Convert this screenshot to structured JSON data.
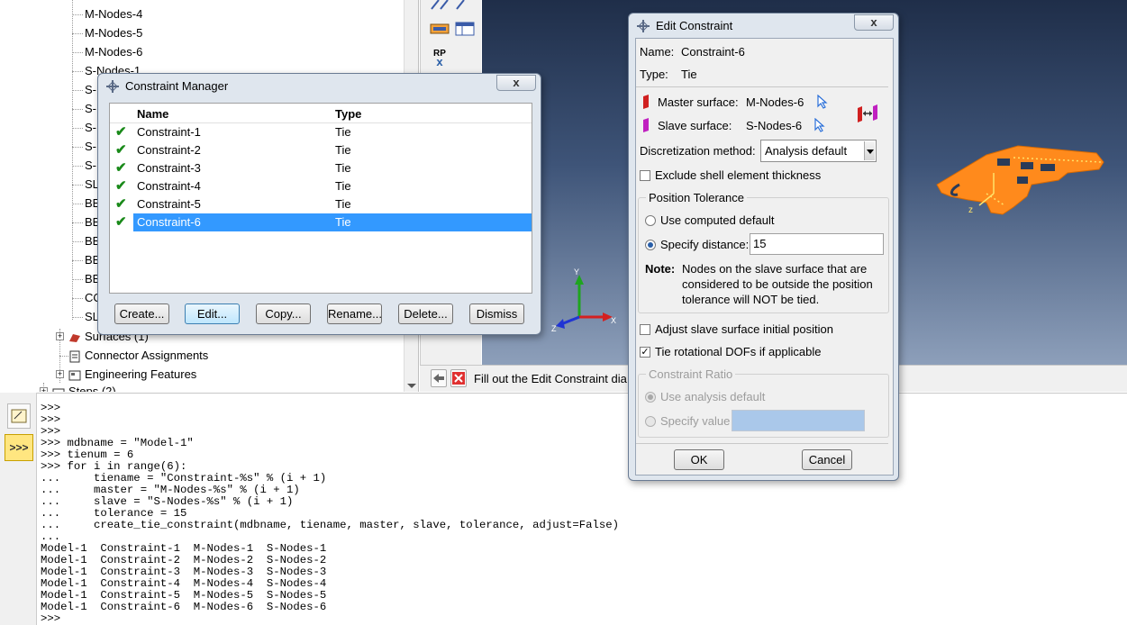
{
  "tree": {
    "items": [
      "M-Nodes-4",
      "M-Nodes-5",
      "M-Nodes-6",
      "S-Nodes-1",
      "S-N",
      "S-N",
      "S-N",
      "S-N",
      "S-N",
      "SLA",
      "BE",
      "BE",
      "BE",
      "BE",
      "BE",
      "CO",
      "SLA"
    ],
    "surfaces": "Surfaces (1)",
    "connector_assignments": "Connector Assignments",
    "engineering_features": "Engineering Features",
    "steps": "Steps (2)"
  },
  "toolbox": {
    "rp_label": "RP"
  },
  "prompt": {
    "text": "Fill out the Edit Constraint dia"
  },
  "viewport": {
    "axis_x": "X",
    "axis_y": "Y",
    "axis_z": "Z"
  },
  "constraint_manager": {
    "title": "Constraint Manager",
    "columns": [
      "Name",
      "Type"
    ],
    "rows": [
      {
        "name": "Constraint-1",
        "type": "Tie"
      },
      {
        "name": "Constraint-2",
        "type": "Tie"
      },
      {
        "name": "Constraint-3",
        "type": "Tie"
      },
      {
        "name": "Constraint-4",
        "type": "Tie"
      },
      {
        "name": "Constraint-5",
        "type": "Tie"
      },
      {
        "name": "Constraint-6",
        "type": "Tie"
      }
    ],
    "selected_index": 5,
    "buttons": {
      "create": "Create...",
      "edit": "Edit...",
      "copy": "Copy...",
      "rename": "Rename...",
      "delete": "Delete...",
      "dismiss": "Dismiss"
    }
  },
  "edit_constraint": {
    "title": "Edit Constraint",
    "name_label": "Name:",
    "name_value": "Constraint-6",
    "type_label": "Type:",
    "type_value": "Tie",
    "master_label": "Master surface:",
    "master_value": "M-Nodes-6",
    "slave_label": "Slave surface:",
    "slave_value": "S-Nodes-6",
    "discretization_label": "Discretization method:",
    "discretization_value": "Analysis default",
    "exclude_shell": "Exclude shell element thickness",
    "position_tolerance": {
      "title": "Position Tolerance",
      "use_computed": "Use computed default",
      "specify_distance": "Specify distance:",
      "distance_value": "15",
      "note_label": "Note:",
      "note_line1": "Nodes on the slave surface that are",
      "note_line2": "considered to be outside the position",
      "note_line3": "tolerance will NOT be tied."
    },
    "adjust_slave": "Adjust slave surface initial position",
    "adjust_checked": false,
    "tie_rotational": "Tie rotational DOFs if applicable",
    "tie_checked": true,
    "constraint_ratio": {
      "title": "Constraint Ratio",
      "use_analysis_default": "Use analysis default",
      "specify_value": "Specify value"
    },
    "ok": "OK",
    "cancel": "Cancel"
  },
  "console": {
    "lines": [
      ">>>",
      ">>>",
      ">>>",
      ">>> mdbname = \"Model-1\"",
      ">>> tienum = 6",
      ">>> for i in range(6):",
      "...     tiename = \"Constraint-%s\" % (i + 1)",
      "...     master = \"M-Nodes-%s\" % (i + 1)",
      "...     slave = \"S-Nodes-%s\" % (i + 1)",
      "...     tolerance = 15",
      "...     create_tie_constraint(mdbname, tiename, master, slave, tolerance, adjust=False)",
      "...",
      "Model-1  Constraint-1  M-Nodes-1  S-Nodes-1",
      "Model-1  Constraint-2  M-Nodes-2  S-Nodes-2",
      "Model-1  Constraint-3  M-Nodes-3  S-Nodes-3",
      "Model-1  Constraint-4  M-Nodes-4  S-Nodes-4",
      "Model-1  Constraint-5  M-Nodes-5  S-Nodes-5",
      "Model-1  Constraint-6  M-Nodes-6  S-Nodes-6",
      ">>>"
    ],
    "side_icons": [
      "message-area-icon",
      "python-shell-icon"
    ]
  },
  "colors": {
    "selection": "#3399ff",
    "model_orange": "#ff8a1c",
    "accent_blue": "#2a5fa8"
  }
}
